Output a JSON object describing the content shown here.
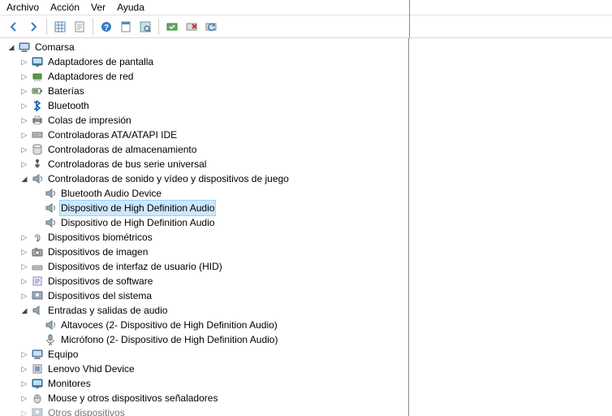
{
  "menu": {
    "archivo": "Archivo",
    "accion": "Acción",
    "ver": "Ver",
    "ayuda": "Ayuda"
  },
  "toolbar": {
    "back": "back",
    "forward": "forward",
    "up": "up",
    "show": "show",
    "help": "help",
    "props": "props",
    "scan": "scan",
    "actA": "actA",
    "actB": "actB",
    "actC": "actC"
  },
  "root": {
    "name": "Comarsa"
  },
  "nodes": {
    "adap_pant": "Adaptadores de pantalla",
    "adap_red": "Adaptadores de red",
    "baterias": "Baterías",
    "bluetooth": "Bluetooth",
    "colas": "Colas de impresión",
    "ata": "Controladoras ATA/ATAPI IDE",
    "almac": "Controladoras de almacenamiento",
    "usb": "Controladoras de bus serie universal",
    "sonido": "Controladoras de sonido y vídeo y dispositivos de juego",
    "bt_audio": "Bluetooth Audio Device",
    "hd1": "Dispositivo de High Definition Audio",
    "hd2": "Dispositivo de High Definition Audio",
    "biom": "Dispositivos biométricos",
    "imagen": "Dispositivos de imagen",
    "hid": "Dispositivos de interfaz de usuario (HID)",
    "softw": "Dispositivos de software",
    "sist": "Dispositivos del sistema",
    "entradas": "Entradas y salidas de audio",
    "altavoces": "Altavoces (2- Dispositivo de High Definition Audio)",
    "microfono": "Micrófono (2- Dispositivo de High Definition Audio)",
    "equipo": "Equipo",
    "lenovo": "Lenovo Vhid Device",
    "monitores": "Monitores",
    "mouse": "Mouse y otros dispositivos señaladores",
    "otros": "Otros dispositivos"
  }
}
